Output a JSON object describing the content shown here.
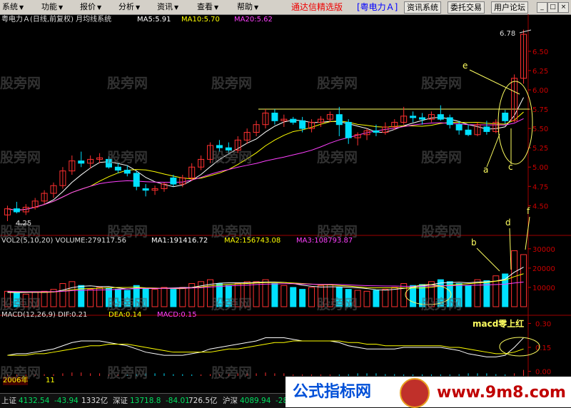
{
  "menu": [
    {
      "label": "系统"
    },
    {
      "label": "功能"
    },
    {
      "label": "报价"
    },
    {
      "label": "分析"
    },
    {
      "label": "资讯"
    },
    {
      "label": "查看"
    },
    {
      "label": "帮助"
    }
  ],
  "brand": "通达信精选版",
  "stock_tag": "[粤电力Ａ]",
  "top_buttons": [
    "资讯系统",
    "委托交易",
    "用户论坛"
  ],
  "price_panel": {
    "title": "粤电力Ａ(日线,前复权) 月均线系统",
    "ma5": "MA5:5.91",
    "ma10": "MA10:5.70",
    "ma20": "MA20:5.62",
    "price_high_label": "6.78",
    "price_low_label": "4.25",
    "annotations": {
      "e": "e",
      "a": "a",
      "c": "c"
    }
  },
  "volume_panel": {
    "title": "VOL2(5,10,20) VOLUME:279117.56",
    "ma1": "MA1:191416.72",
    "ma2": "MA2:156743.08",
    "ma3": "MA3:108793.87",
    "annotations": {
      "b": "b",
      "d": "d",
      "f": "f"
    }
  },
  "macd_panel": {
    "title": "MACD(12,26,9) DIF:0.21",
    "dea": "DEA:0.14",
    "macd": "MACD:0.15",
    "note": "macd零上红"
  },
  "date_label": "2006年",
  "month_label": "11",
  "watermark": "股旁网",
  "bottom": {
    "sh_label": "上证",
    "sh_value": "4132.54",
    "sh_change": "-43.94",
    "sh_amount": "1332亿",
    "sz_label": "深证",
    "sz_value": "13718.8",
    "sz_change": "-84.01",
    "sz_amount": "726.5亿",
    "hs_label": "沪深",
    "hs_value": "4089.94",
    "hs_change": "-28"
  },
  "promo": {
    "left": "公式指标网",
    "right": "www.9m8.com"
  },
  "chart_data": {
    "type": "candlestick",
    "price_axis": {
      "ylim": [
        4.25,
        6.78
      ],
      "ticks": [
        "6.50",
        "6.25",
        "6.00",
        "5.75",
        "5.50",
        "5.25",
        "5.00",
        "4.75",
        "4.50"
      ]
    },
    "volume_axis": {
      "ticks": [
        "30000",
        "20000",
        "10000"
      ]
    },
    "macd_axis": {
      "ticks": [
        "0.30",
        "0.15",
        "0.00"
      ]
    },
    "colors": {
      "up": "#ff3030",
      "down": "#00e0ff",
      "ma5": "#ffffff",
      "ma10": "#ffff00",
      "ma20": "#ff40ff",
      "grid": "#a00000",
      "annotation": "#ffff60"
    },
    "candles": [
      {
        "o": 4.38,
        "h": 4.5,
        "l": 4.3,
        "c": 4.46
      },
      {
        "o": 4.46,
        "h": 4.55,
        "l": 4.4,
        "c": 4.42
      },
      {
        "o": 4.42,
        "h": 4.52,
        "l": 4.38,
        "c": 4.48
      },
      {
        "o": 4.48,
        "h": 4.6,
        "l": 4.45,
        "c": 4.56
      },
      {
        "o": 4.56,
        "h": 4.7,
        "l": 4.52,
        "c": 4.66
      },
      {
        "o": 4.66,
        "h": 4.8,
        "l": 4.6,
        "c": 4.76
      },
      {
        "o": 4.76,
        "h": 5.0,
        "l": 4.72,
        "c": 4.95
      },
      {
        "o": 4.95,
        "h": 5.15,
        "l": 4.9,
        "c": 5.08
      },
      {
        "o": 5.08,
        "h": 5.2,
        "l": 5.0,
        "c": 5.05
      },
      {
        "o": 5.05,
        "h": 5.15,
        "l": 4.98,
        "c": 5.1
      },
      {
        "o": 5.1,
        "h": 5.18,
        "l": 5.05,
        "c": 5.12
      },
      {
        "o": 5.1,
        "h": 5.14,
        "l": 4.98,
        "c": 5.0
      },
      {
        "o": 5.0,
        "h": 5.05,
        "l": 4.92,
        "c": 4.96
      },
      {
        "o": 4.96,
        "h": 5.02,
        "l": 4.88,
        "c": 4.92
      },
      {
        "o": 4.92,
        "h": 4.95,
        "l": 4.7,
        "c": 4.75
      },
      {
        "o": 4.72,
        "h": 4.78,
        "l": 4.62,
        "c": 4.7
      },
      {
        "o": 4.7,
        "h": 4.76,
        "l": 4.64,
        "c": 4.72
      },
      {
        "o": 4.72,
        "h": 4.8,
        "l": 4.68,
        "c": 4.78
      },
      {
        "o": 4.86,
        "h": 4.9,
        "l": 4.75,
        "c": 4.78
      },
      {
        "o": 4.78,
        "h": 4.9,
        "l": 4.74,
        "c": 4.86
      },
      {
        "o": 4.86,
        "h": 5.05,
        "l": 4.82,
        "c": 5.0
      },
      {
        "o": 5.0,
        "h": 5.15,
        "l": 4.96,
        "c": 5.1
      },
      {
        "o": 5.1,
        "h": 5.32,
        "l": 5.05,
        "c": 5.28
      },
      {
        "o": 5.28,
        "h": 5.35,
        "l": 5.2,
        "c": 5.25
      },
      {
        "o": 5.25,
        "h": 5.32,
        "l": 5.18,
        "c": 5.22
      },
      {
        "o": 5.22,
        "h": 5.4,
        "l": 5.18,
        "c": 5.35
      },
      {
        "o": 5.35,
        "h": 5.5,
        "l": 5.3,
        "c": 5.45
      },
      {
        "o": 5.45,
        "h": 5.6,
        "l": 5.4,
        "c": 5.55
      },
      {
        "o": 5.55,
        "h": 5.75,
        "l": 5.5,
        "c": 5.7
      },
      {
        "o": 5.7,
        "h": 5.75,
        "l": 5.55,
        "c": 5.6
      },
      {
        "o": 5.6,
        "h": 5.68,
        "l": 5.52,
        "c": 5.62
      },
      {
        "o": 5.62,
        "h": 5.65,
        "l": 5.55,
        "c": 5.58
      },
      {
        "o": 5.6,
        "h": 5.65,
        "l": 5.45,
        "c": 5.5
      },
      {
        "o": 5.5,
        "h": 5.62,
        "l": 5.45,
        "c": 5.58
      },
      {
        "o": 5.58,
        "h": 5.66,
        "l": 5.52,
        "c": 5.62
      },
      {
        "o": 5.62,
        "h": 5.72,
        "l": 5.58,
        "c": 5.68
      },
      {
        "o": 5.68,
        "h": 5.78,
        "l": 5.4,
        "c": 5.55
      },
      {
        "o": 5.58,
        "h": 5.62,
        "l": 5.3,
        "c": 5.38
      },
      {
        "o": 5.38,
        "h": 5.45,
        "l": 5.28,
        "c": 5.42
      },
      {
        "o": 5.42,
        "h": 5.5,
        "l": 5.35,
        "c": 5.47
      },
      {
        "o": 5.47,
        "h": 5.55,
        "l": 5.4,
        "c": 5.45
      },
      {
        "o": 5.45,
        "h": 5.58,
        "l": 5.42,
        "c": 5.52
      },
      {
        "o": 5.52,
        "h": 5.62,
        "l": 5.48,
        "c": 5.58
      },
      {
        "o": 5.58,
        "h": 5.78,
        "l": 5.55,
        "c": 5.66
      },
      {
        "o": 5.66,
        "h": 5.72,
        "l": 5.58,
        "c": 5.64
      },
      {
        "o": 5.64,
        "h": 5.7,
        "l": 5.55,
        "c": 5.62
      },
      {
        "o": 5.62,
        "h": 5.72,
        "l": 5.58,
        "c": 5.68
      },
      {
        "o": 5.68,
        "h": 5.8,
        "l": 5.6,
        "c": 5.62
      },
      {
        "o": 5.64,
        "h": 5.68,
        "l": 5.5,
        "c": 5.55
      },
      {
        "o": 5.55,
        "h": 5.6,
        "l": 5.42,
        "c": 5.48
      },
      {
        "o": 5.48,
        "h": 5.55,
        "l": 5.4,
        "c": 5.42
      },
      {
        "o": 5.42,
        "h": 5.58,
        "l": 5.4,
        "c": 5.55
      },
      {
        "o": 5.52,
        "h": 5.6,
        "l": 5.42,
        "c": 5.46
      },
      {
        "o": 5.46,
        "h": 5.62,
        "l": 5.44,
        "c": 5.58
      },
      {
        "o": 5.7,
        "h": 5.74,
        "l": 5.56,
        "c": 5.6
      },
      {
        "o": 5.6,
        "h": 6.2,
        "l": 5.58,
        "c": 6.15
      },
      {
        "o": 6.15,
        "h": 6.78,
        "l": 6.08,
        "c": 6.72
      }
    ],
    "volumes": [
      8000,
      7000,
      6500,
      7500,
      8000,
      9000,
      12000,
      13000,
      11000,
      9000,
      10000,
      9500,
      9000,
      8500,
      11000,
      9500,
      9000,
      10000,
      9000,
      10000,
      12000,
      13000,
      14000,
      12000,
      11000,
      12000,
      13000,
      13000,
      14000,
      12000,
      11000,
      10000,
      9000,
      10000,
      11000,
      11500,
      10000,
      9000,
      8500,
      8000,
      8500,
      9000,
      10000,
      12000,
      11000,
      11500,
      13000,
      14000,
      13000,
      12000,
      11000,
      14000,
      13500,
      16000,
      17000,
      29000,
      27000
    ],
    "vol_ma5": [
      7400,
      7300,
      7400,
      7500,
      7400,
      7600,
      8600,
      9900,
      10600,
      10800,
      10400,
      10500,
      9700,
      9200,
      9600,
      9500,
      9400,
      9600,
      9700,
      9900,
      10000,
      10800,
      11600,
      12200,
      12400,
      12400,
      12400,
      12600,
      12800,
      12800,
      12600,
      12000,
      11200,
      10600,
      10200,
      10300,
      10300,
      10100,
      9800,
      9400,
      8800,
      8600,
      9000,
      9500,
      10100,
      10700,
      11500,
      12300,
      12500,
      12700,
      12400,
      12800,
      12900,
      13300,
      14300,
      17900,
      20500
    ],
    "vol_ma10": [
      7800,
      7700,
      7600,
      7600,
      7500,
      7600,
      8100,
      8800,
      9300,
      9400,
      9600,
      9800,
      10000,
      10000,
      10100,
      9800,
      9700,
      9500,
      9400,
      9400,
      9800,
      10200,
      10800,
      11300,
      11600,
      11800,
      12000,
      12300,
      12500,
      12500,
      12500,
      12300,
      12000,
      11700,
      11400,
      11300,
      11000,
      10700,
      10300,
      9900,
      9800,
      9800,
      9800,
      9700,
      9700,
      9700,
      10100,
      10700,
      11200,
      11600,
      11900,
      12300,
      12600,
      13200,
      13800,
      15600,
      17100
    ],
    "vol_ma20": [
      8000,
      7900,
      7800,
      7800,
      7800,
      7800,
      8000,
      8300,
      8500,
      8600,
      8700,
      8800,
      9000,
      9200,
      9400,
      9500,
      9500,
      9500,
      9500,
      9600,
      9700,
      9900,
      10200,
      10500,
      10800,
      11000,
      11200,
      11500,
      11700,
      11800,
      11900,
      11900,
      11800,
      11700,
      11600,
      11600,
      11500,
      11300,
      11100,
      10900,
      10800,
      10700,
      10700,
      10600,
      10600,
      10600,
      10700,
      10800,
      10900,
      11000,
      11100,
      11200,
      11300,
      11500,
      11700,
      12300,
      12800
    ],
    "macd_dif": [
      0.1,
      0.11,
      0.11,
      0.12,
      0.13,
      0.14,
      0.16,
      0.18,
      0.19,
      0.19,
      0.19,
      0.18,
      0.17,
      0.16,
      0.14,
      0.12,
      0.11,
      0.1,
      0.1,
      0.1,
      0.11,
      0.12,
      0.14,
      0.15,
      0.16,
      0.17,
      0.18,
      0.19,
      0.21,
      0.21,
      0.21,
      0.2,
      0.19,
      0.19,
      0.19,
      0.19,
      0.18,
      0.16,
      0.15,
      0.14,
      0.14,
      0.14,
      0.14,
      0.15,
      0.15,
      0.15,
      0.15,
      0.15,
      0.14,
      0.13,
      0.11,
      0.1,
      0.09,
      0.09,
      0.1,
      0.15,
      0.21
    ],
    "macd_dea": [
      0.1,
      0.1,
      0.1,
      0.11,
      0.11,
      0.12,
      0.13,
      0.14,
      0.15,
      0.16,
      0.16,
      0.17,
      0.17,
      0.17,
      0.16,
      0.15,
      0.14,
      0.13,
      0.12,
      0.12,
      0.12,
      0.12,
      0.12,
      0.13,
      0.14,
      0.14,
      0.15,
      0.16,
      0.17,
      0.18,
      0.18,
      0.19,
      0.19,
      0.19,
      0.19,
      0.19,
      0.19,
      0.18,
      0.18,
      0.17,
      0.17,
      0.16,
      0.16,
      0.16,
      0.16,
      0.16,
      0.16,
      0.16,
      0.15,
      0.15,
      0.14,
      0.13,
      0.12,
      0.11,
      0.11,
      0.12,
      0.14
    ]
  }
}
